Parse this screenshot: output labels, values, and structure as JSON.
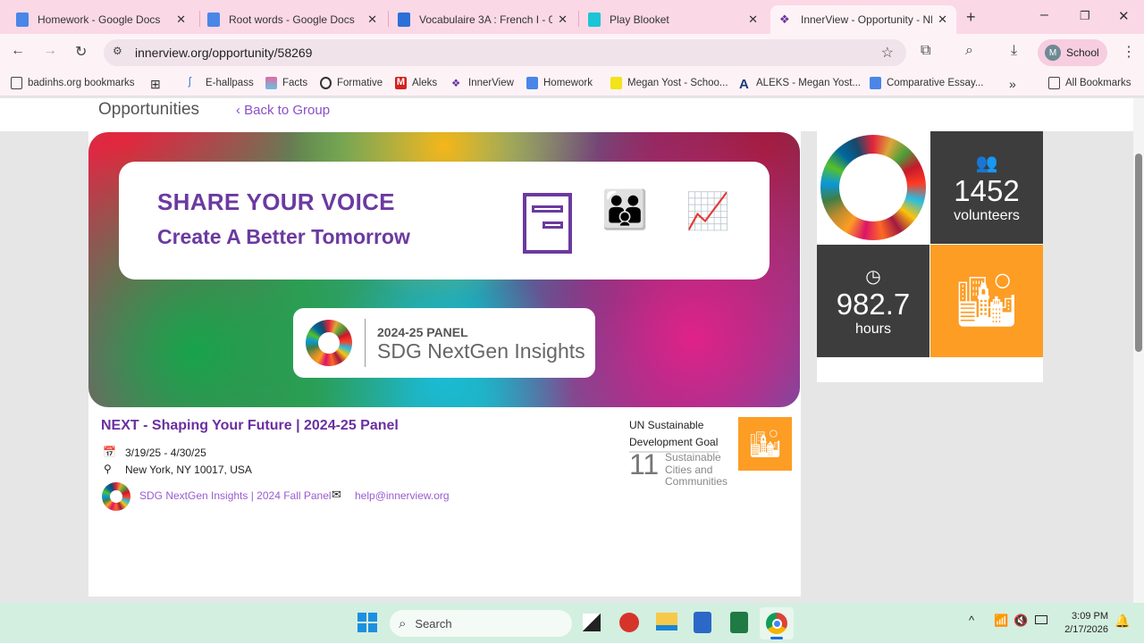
{
  "browser": {
    "tabs": [
      {
        "title": "Homework - Google Docs",
        "color": "#4a86e8"
      },
      {
        "title": "Root words - Google Docs",
        "color": "#4a86e8"
      },
      {
        "title": "Vocabulaire 3A : French I - 06",
        "color": "#2c6fd6"
      },
      {
        "title": "Play Blooket",
        "color": "#1cc5d6"
      },
      {
        "title": "InnerView - Opportunity - NE",
        "color": "#6b2fa0"
      }
    ],
    "url": "innerview.org/opportunity/58269",
    "profile_initial": "M",
    "profile_label": "School",
    "bookmarks": [
      "badinhs.org bookmarks",
      "E-hallpass",
      "Facts",
      "Formative",
      "Aleks",
      "InnerView",
      "Homework",
      "Megan Yost - Schoo...",
      "ALEKS - Megan Yost...",
      "Comparative Essay..."
    ],
    "all_bookmarks": "All Bookmarks"
  },
  "page": {
    "heading": "Opportunities",
    "back_link": "Back to Group",
    "banner": {
      "line1": "SHARE YOUR VOICE",
      "line2": "Create A Better Tomorrow",
      "panel_year": "2024-25 PANEL",
      "panel_name": "SDG NextGen Insights"
    },
    "title": "NEXT - Shaping Your Future | 2024-25 Panel",
    "dates": "3/19/25 - 4/30/25",
    "location": "New York, NY 10017, USA",
    "group_link": "SDG NextGen Insights | 2024 Fall Panel",
    "email": "help@innerview.org",
    "sdg": {
      "label": "UN Sustainable Development Goal",
      "number": "11",
      "name": "Sustainable Cities and Communities",
      "color": "#fd9d24"
    },
    "stats": {
      "volunteers_value": "1452",
      "volunteers_label": "volunteers",
      "hours_value": "982.7",
      "hours_label": "hours"
    }
  },
  "taskbar": {
    "search": "Search",
    "time": "3:09 PM",
    "date": "2/17/2026"
  }
}
